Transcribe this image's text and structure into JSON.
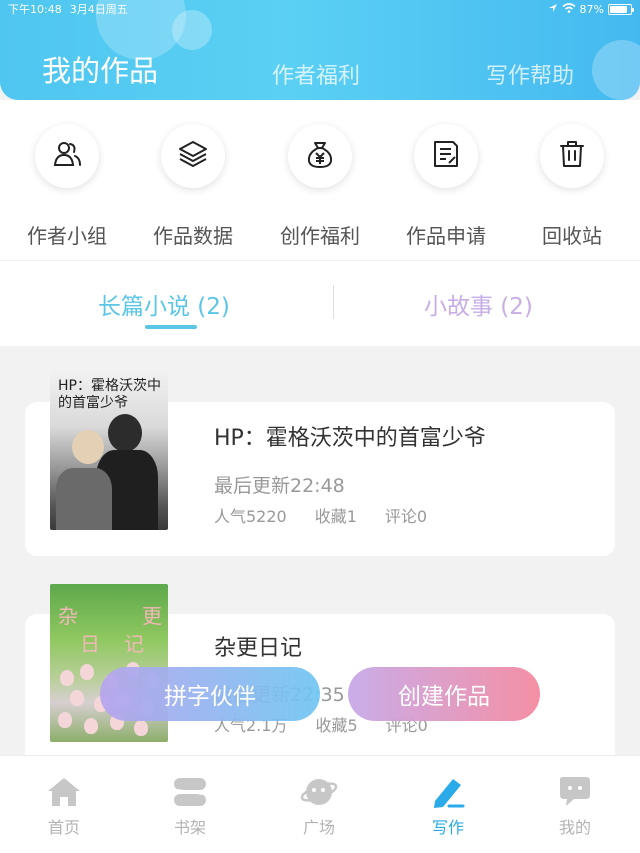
{
  "status_bar": {
    "time": "下午10:48",
    "date": "3月4日周五",
    "battery": "87%",
    "battery_level": 0.87
  },
  "header": {
    "tabs": [
      {
        "label": "我的作品",
        "active": true
      },
      {
        "label": "作者福利",
        "active": false
      },
      {
        "label": "写作帮助",
        "active": false
      }
    ]
  },
  "quick_actions": [
    {
      "label": "作者小组",
      "icon": "group-icon"
    },
    {
      "label": "作品数据",
      "icon": "layers-icon"
    },
    {
      "label": "创作福利",
      "icon": "money-bag-icon"
    },
    {
      "label": "作品申请",
      "icon": "document-icon"
    },
    {
      "label": "回收站",
      "icon": "trash-icon"
    }
  ],
  "sub_tabs": [
    {
      "label": "长篇小说 (2)",
      "active": true
    },
    {
      "label": "小故事 (2)",
      "active": false
    }
  ],
  "works": [
    {
      "title": "HP：霍格沃茨中的首富少爷",
      "cover_text": "HP：霍格沃茨中的首富少爷",
      "updated": "最后更新22:48",
      "popularity": "人气5220",
      "favorites": "收藏1",
      "comments": "评论0"
    },
    {
      "title": "杂更日记",
      "cover_text_1": "杂",
      "cover_text_2": "更",
      "cover_text_3": "日",
      "cover_text_4": "记",
      "updated": "最后更新22:35",
      "popularity": "人气2.1万",
      "favorites": "收藏5",
      "comments": "评论0"
    }
  ],
  "floating_buttons": {
    "partner": "拼字伙伴",
    "create": "创建作品"
  },
  "bottom_nav": [
    {
      "label": "首页",
      "icon": "home-icon",
      "active": false
    },
    {
      "label": "书架",
      "icon": "bookshelf-icon",
      "active": false
    },
    {
      "label": "广场",
      "icon": "planet-icon",
      "active": false
    },
    {
      "label": "写作",
      "icon": "pen-icon",
      "active": true
    },
    {
      "label": "我的",
      "icon": "chat-bubble-icon",
      "active": false
    }
  ],
  "colors": {
    "accent": "#5bc6e6",
    "nav_active": "#2aaae8",
    "secondary_tab": "#c7aee6"
  }
}
